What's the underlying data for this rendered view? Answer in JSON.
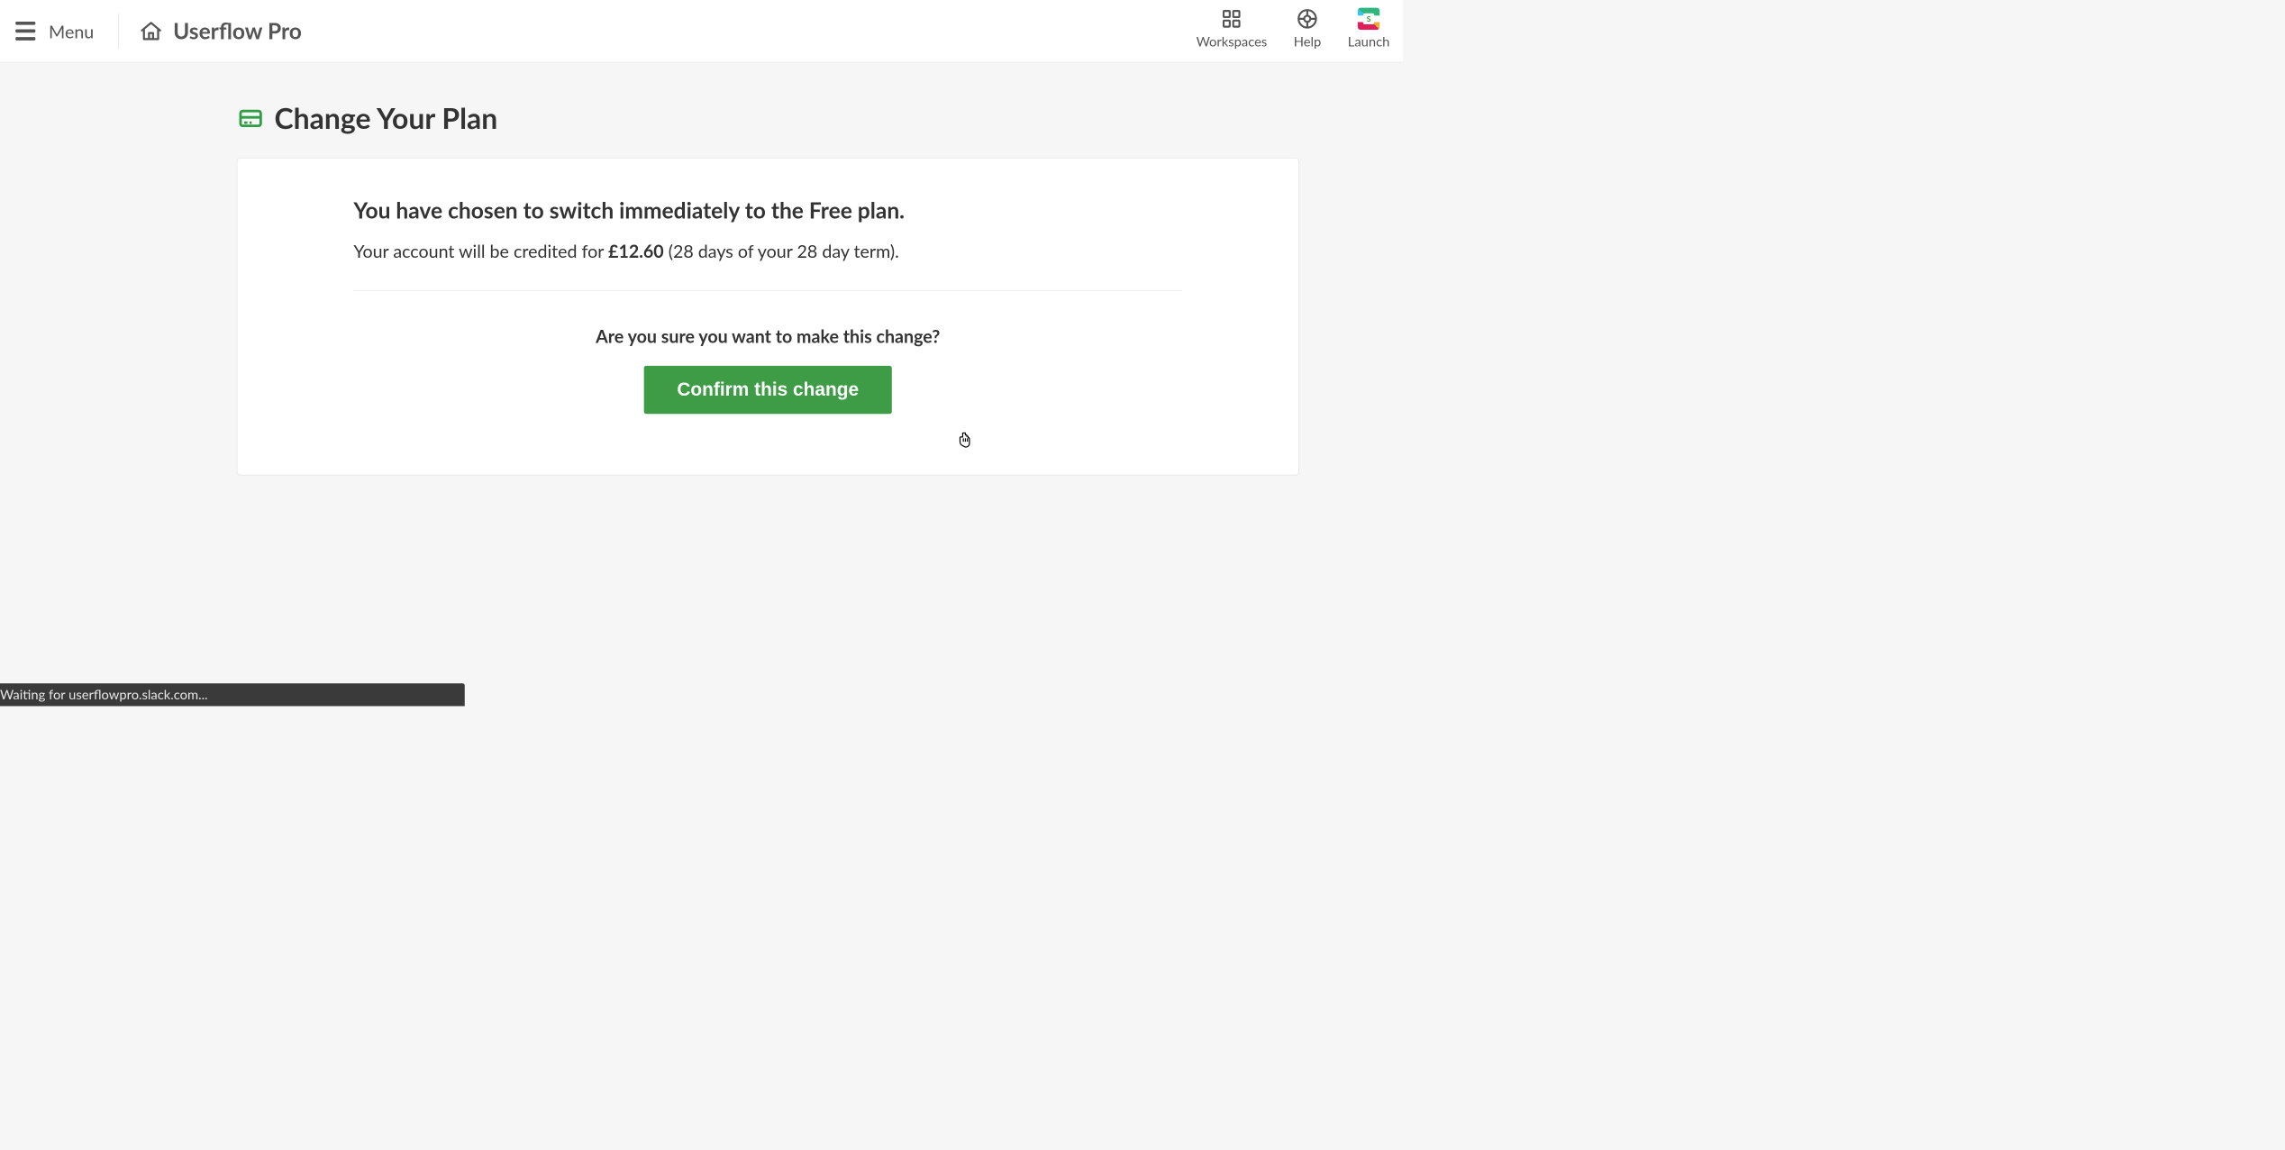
{
  "header": {
    "menu_label": "Menu",
    "brand": "Userflow Pro",
    "workspaces_label": "Workspaces",
    "help_label": "Help",
    "launch_label": "Launch",
    "launcher_letter": "S"
  },
  "page": {
    "title": "Change Your Plan"
  },
  "card": {
    "headline": "You have chosen to switch immediately to the Free plan.",
    "credit_prefix": "Your account will be credited for ",
    "credit_amount": "£12.60",
    "credit_suffix": " (28 days of your 28 day term).",
    "confirm_question": "Are you sure you want to make this change?",
    "confirm_button": "Confirm this change"
  },
  "status": {
    "text": "Waiting for userflowpro.slack.com..."
  }
}
